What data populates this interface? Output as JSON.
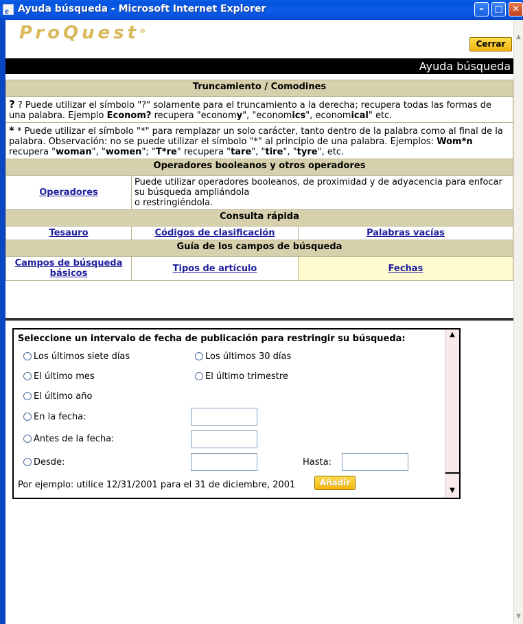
{
  "window": {
    "title": "Ayuda búsqueda - Microsoft Internet Explorer",
    "min_glyph": "–",
    "max_glyph": "□",
    "close_glyph": "✕",
    "app_icon_glyph": "e"
  },
  "header": {
    "logo": "ProQuest",
    "logo_mark": "®",
    "close_button": "Cerrar",
    "banner": "Ayuda búsqueda"
  },
  "sections": {
    "truncation": {
      "heading": "Truncamiento / Comodines",
      "q_symbol": "?",
      "q_text_1": " ? Puede utilizar el símbolo \"?\" solamente para el truncamiento a la derecha; recupera todas las formas de una palabra. Ejemplo ",
      "q_example": "Econom?",
      "q_text_2": " recupera \"econom",
      "q_y": "y",
      "q_text_3": "\", \"econom",
      "q_ics": "ics",
      "q_text_4": "\", econom",
      "q_ical": "ical",
      "q_text_5": "\" etc.",
      "s_symbol": "*",
      "s_text_1": " * Puede utilizar el símbolo \"*\" para remplazar un solo carácter, tanto dentro de la palabra como al final de la palabra. Observación: no se puede utilizar el símbolo \"*\" al principio de una palabra. Ejemplos: ",
      "s_ex1": "Wom*n",
      "s_text_2": " recupera \"",
      "s_woman": "woman",
      "s_text_3": "\", \"",
      "s_women": "women",
      "s_text_4": "\"; \"",
      "s_ex2": "T*re",
      "s_text_5": "\" recupera \"",
      "s_tare": "tare",
      "s_text_6": "\", \"",
      "s_tire": "tire",
      "s_text_7": "\", \"",
      "s_tyre": "tyre",
      "s_text_8": "\", etc."
    },
    "boolean": {
      "heading": "Operadores booleanos y otros operadores",
      "link": "Operadores",
      "desc_1": "Puede utilizar operadores booleanos, de proximidad y de adyacencia para enfocar su búsqueda ampliándola",
      "desc_2": "o restringiéndola."
    },
    "quick": {
      "heading": "Consulta rápida",
      "links": [
        "Tesauro",
        "Códigos de clasificación",
        "Palabras vacías"
      ]
    },
    "fields": {
      "heading": "Guía de los campos de búsqueda",
      "links": [
        "Campos de búsqueda básicos",
        "Tipos de artículo",
        "Fechas"
      ]
    }
  },
  "date_panel": {
    "title": "Seleccione un intervalo de fecha de publicación para restringir su búsqueda:",
    "options": {
      "last7": "Los últimos siete días",
      "last30": "Los últimos 30 días",
      "last_month": "El último mes",
      "last_quarter": "El último trimestre",
      "last_year": "El último año",
      "on_date": "En la fecha:",
      "before_date": "Antes de la fecha:",
      "from": "Desde:"
    },
    "until_label": "Hasta:",
    "example": "Por ejemplo: utilice 12/31/2001 para el 31 de diciembre, 2001",
    "add_button": "Añadir",
    "scroll_up": "▲",
    "scroll_down": "▼"
  },
  "colors": {
    "section_bg": "#d6d1ac",
    "link": "#1e1e9e",
    "button_gold": "#f2b30c",
    "title_bar_blue": "#0453de"
  },
  "icons": {
    "app": "ie-icon",
    "minimize": "minimize-icon",
    "maximize": "maximize-icon",
    "close": "close-icon"
  }
}
